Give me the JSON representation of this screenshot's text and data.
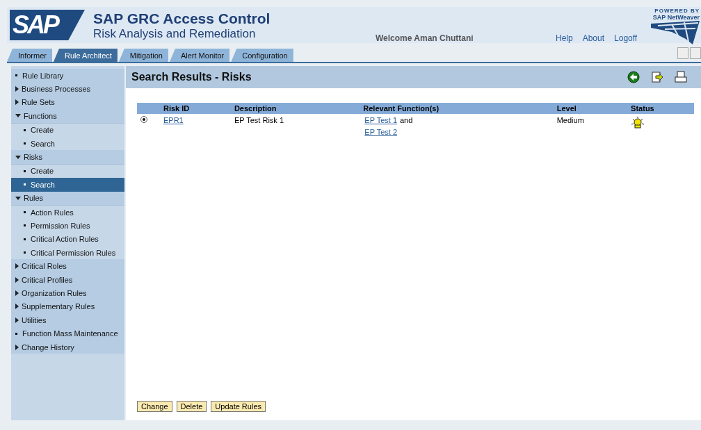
{
  "header": {
    "logo": "SAP",
    "title": "SAP GRC Access Control",
    "subtitle": "Risk Analysis and Remediation",
    "welcome": "Welcome Aman Chuttani",
    "links": [
      "Help",
      "About",
      "Logoff"
    ],
    "powered_by": "POWERED BY",
    "platform": "SAP NetWeaver"
  },
  "tabs": [
    {
      "label": "Informer",
      "selected": false
    },
    {
      "label": "Rule Architect",
      "selected": true
    },
    {
      "label": "Mitigation",
      "selected": false
    },
    {
      "label": "Alert Monitor",
      "selected": false
    },
    {
      "label": "Configuration",
      "selected": false
    }
  ],
  "sidebar": {
    "items": [
      {
        "label": "Rule Library",
        "kind": "leaf",
        "selected": false
      },
      {
        "label": "Business Processes",
        "kind": "group",
        "expanded": false,
        "selected": false
      },
      {
        "label": "Rule Sets",
        "kind": "group",
        "expanded": false,
        "selected": false
      },
      {
        "label": "Functions",
        "kind": "group",
        "expanded": true,
        "selected": false,
        "children": [
          {
            "label": "Create",
            "selected": false
          },
          {
            "label": "Search",
            "selected": false
          }
        ]
      },
      {
        "label": "Risks",
        "kind": "group",
        "expanded": true,
        "selected": false,
        "children": [
          {
            "label": "Create",
            "selected": false
          },
          {
            "label": "Search",
            "selected": true
          }
        ]
      },
      {
        "label": "Rules",
        "kind": "group",
        "expanded": true,
        "selected": false,
        "children": [
          {
            "label": "Action Rules",
            "selected": false
          },
          {
            "label": "Permission Rules",
            "selected": false
          },
          {
            "label": "Critical Action Rules",
            "selected": false
          },
          {
            "label": "Critical Permission Rules",
            "selected": false
          }
        ]
      },
      {
        "label": "Critical Roles",
        "kind": "group",
        "expanded": false,
        "selected": false
      },
      {
        "label": "Critical Profiles",
        "kind": "group",
        "expanded": false,
        "selected": false
      },
      {
        "label": "Organization Rules",
        "kind": "group",
        "expanded": false,
        "selected": false
      },
      {
        "label": "Supplementary Rules",
        "kind": "group",
        "expanded": false,
        "selected": false
      },
      {
        "label": "Utilities",
        "kind": "group",
        "expanded": false,
        "selected": false
      },
      {
        "label": "Function Mass Maintenance",
        "kind": "leaf",
        "selected": false
      },
      {
        "label": "Change History",
        "kind": "group",
        "expanded": false,
        "selected": false
      }
    ]
  },
  "content": {
    "title": "Search Results - Risks",
    "table": {
      "columns": [
        "Risk ID",
        "Description",
        "Relevant Function(s)",
        "Level",
        "Status"
      ],
      "rows": [
        {
          "selected": true,
          "risk_id": "EPR1",
          "description": "EP Test Risk 1",
          "functions": [
            "EP Test 1",
            "EP Test 2"
          ],
          "joiner": "and",
          "level": "Medium"
        }
      ]
    },
    "buttons": [
      "Change",
      "Delete",
      "Update Rules"
    ]
  }
}
